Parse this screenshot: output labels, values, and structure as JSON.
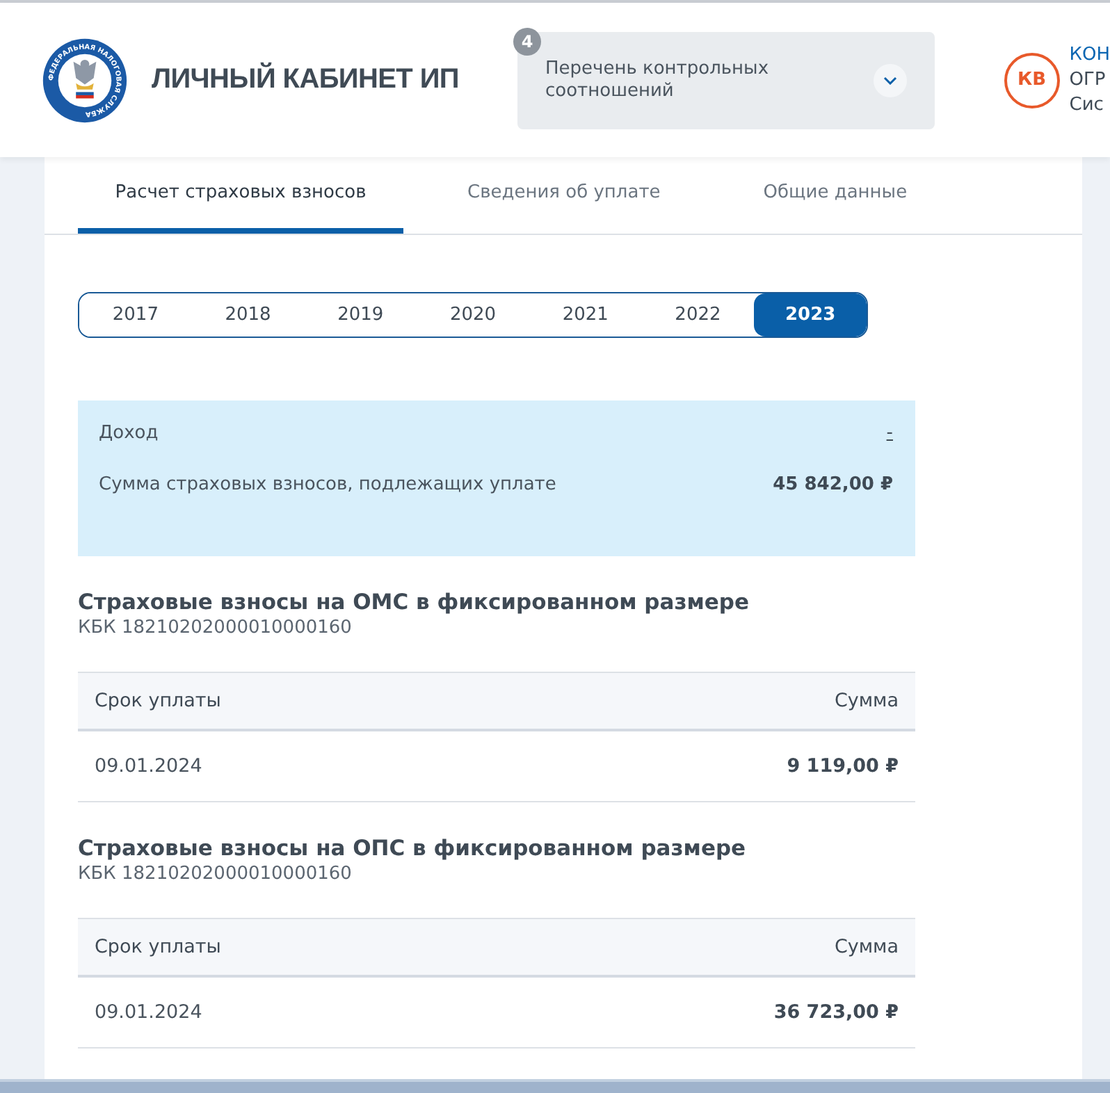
{
  "header": {
    "logo_text": "ФЕДЕРАЛЬНАЯ НАЛОГОВАЯ СЛУЖБА",
    "title": "ЛИЧНЫЙ КАБИНЕТ ИП",
    "dropdown": {
      "badge": "4",
      "label": "Перечень контрольных соотношений",
      "expanded": false
    },
    "user": {
      "initials": "КВ",
      "name": "КОН",
      "line_2": "ОГР",
      "line_3": "Сис"
    }
  },
  "tabs": [
    {
      "label": "Расчет страховых взносов",
      "selected": true
    },
    {
      "label": "Сведения об уплате",
      "selected": false
    },
    {
      "label": "Общие данные",
      "selected": false
    }
  ],
  "years": [
    {
      "label": "2017",
      "selected": false
    },
    {
      "label": "2018",
      "selected": false
    },
    {
      "label": "2019",
      "selected": false
    },
    {
      "label": "2020",
      "selected": false
    },
    {
      "label": "2021",
      "selected": false
    },
    {
      "label": "2022",
      "selected": false
    },
    {
      "label": "2023",
      "selected": true
    }
  ],
  "summary": [
    {
      "label": "Доход",
      "value": "-",
      "kind": "link"
    },
    {
      "label": "Сумма страховых взносов, подлежащих уплате",
      "value": "45 842,00 ₽",
      "kind": "amount"
    }
  ],
  "sections": [
    {
      "title": "Страховые взносы на ОМС в фиксированном размере",
      "kbk": "КБК 18210202000010000160",
      "columns": [
        "Срок уплаты",
        "Сумма"
      ],
      "rows": [
        [
          "09.01.2024",
          "9 119,00 ₽"
        ]
      ]
    },
    {
      "title": "Страховые взносы на ОПС в фиксированном размере",
      "kbk": "КБК 18210202000010000160",
      "columns": [
        "Срок уплаты",
        "Сумма"
      ],
      "rows": [
        [
          "09.01.2024",
          "36 723,00 ₽"
        ]
      ]
    }
  ]
}
